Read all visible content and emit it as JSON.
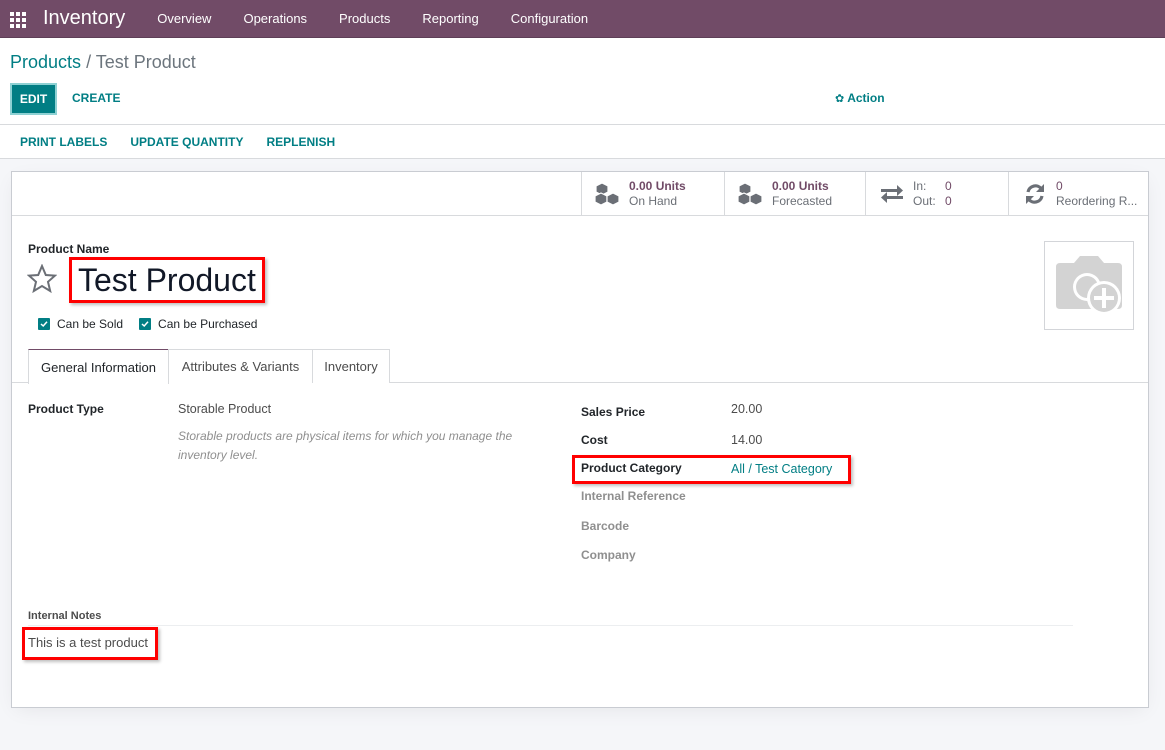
{
  "navbar": {
    "app_name": "Inventory",
    "menu": [
      "Overview",
      "Operations",
      "Products",
      "Reporting",
      "Configuration"
    ],
    "background_color": "#714b67"
  },
  "breadcrumb": {
    "parent": "Products",
    "separator": "/",
    "current": "Test Product"
  },
  "control_panel": {
    "edit_label": "EDIT",
    "create_label": "CREATE",
    "action_label": "Action",
    "action_icon": "gear-icon",
    "accent_color": "#017e84"
  },
  "statusbar": {
    "buttons": [
      "PRINT LABELS",
      "UPDATE QUANTITY",
      "REPLENISH"
    ]
  },
  "smart_buttons": {
    "on_hand": {
      "value": "0.00 Units",
      "label": "On Hand",
      "icon": "cubes-icon"
    },
    "forecasted": {
      "value": "0.00 Units",
      "label": "Forecasted",
      "icon": "cubes-icon"
    },
    "in_out": {
      "in_label": "In:",
      "in_value": "0",
      "out_label": "Out:",
      "out_value": "0",
      "icon": "exchange-arrows-icon"
    },
    "reordering": {
      "value": "0",
      "label": "Reordering R...",
      "icon": "refresh-icon"
    }
  },
  "product": {
    "name_label": "Product Name",
    "name": "Test Product",
    "favorite": false,
    "can_be_sold_label": "Can be Sold",
    "can_be_sold": true,
    "can_be_purchased_label": "Can be Purchased",
    "can_be_purchased": true,
    "image_icon": "camera-plus-icon"
  },
  "tabs": [
    {
      "label": "General Information",
      "active": true
    },
    {
      "label": "Attributes & Variants",
      "active": false
    },
    {
      "label": "Inventory",
      "active": false
    }
  ],
  "general": {
    "product_type_label": "Product Type",
    "product_type": "Storable Product",
    "product_type_help": "Storable products are physical items for which you manage the inventory level.",
    "sales_price_label": "Sales Price",
    "sales_price": "20.00",
    "cost_label": "Cost",
    "cost": "14.00",
    "category_label": "Product Category",
    "category": "All / Test Category",
    "internal_ref_label": "Internal Reference",
    "barcode_label": "Barcode",
    "company_label": "Company"
  },
  "notes": {
    "label": "Internal Notes",
    "text": "This is a test product"
  },
  "highlight_color": "#ff0000"
}
